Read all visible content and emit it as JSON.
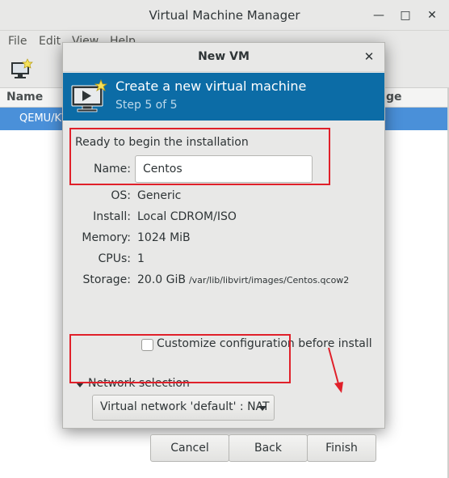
{
  "main_window": {
    "title": "Virtual Machine Manager",
    "minimize_icon": "minimize-icon",
    "maximize_icon": "maximize-icon",
    "close_icon": "close-icon",
    "menu": [
      "File",
      "Edit",
      "View",
      "Help"
    ],
    "columns": {
      "name": "Name",
      "usage": "ge"
    },
    "connection_row": "QEMU/KV"
  },
  "dialog": {
    "title": "New VM",
    "header_title": "Create a new virtual machine",
    "header_step": "Step 5 of 5",
    "ready_text": "Ready to begin the installation",
    "name_label": "Name:",
    "name_value": "Centos",
    "os_label": "OS:",
    "os_value": "Generic",
    "install_label": "Install:",
    "install_value": "Local CDROM/ISO",
    "memory_label": "Memory:",
    "memory_value": "1024 MiB",
    "cpus_label": "CPUs:",
    "cpus_value": "1",
    "storage_label": "Storage:",
    "storage_value": "20.0 GiB",
    "storage_path": "/var/lib/libvirt/images/Centos.qcow2",
    "customize_label": "Customize configuration before install",
    "customize_checked": false,
    "network_section_label": "Network selection",
    "network_value": "Virtual network 'default' : NAT",
    "buttons": {
      "cancel": "Cancel",
      "back": "Back",
      "finish": "Finish"
    }
  },
  "colors": {
    "header_bg": "#0c6ca6",
    "selection": "#4a90d9",
    "annotation": "#e0202a"
  }
}
